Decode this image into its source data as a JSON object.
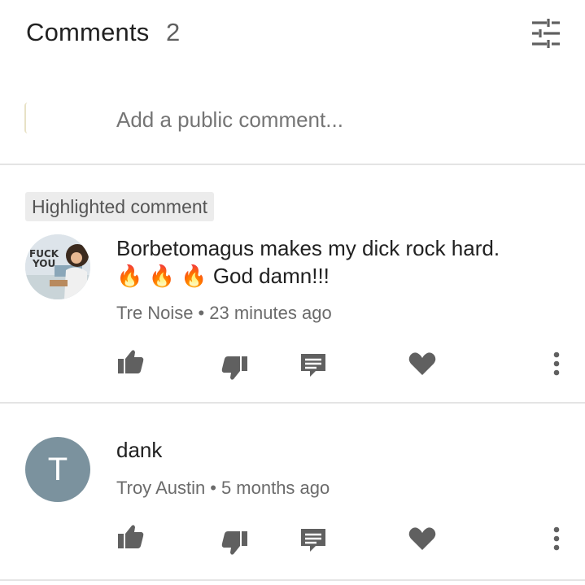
{
  "header": {
    "title": "Comments",
    "count": "2"
  },
  "add_comment": {
    "placeholder": "Add a public comment..."
  },
  "highlighted_label": "Highlighted comment",
  "comments": [
    {
      "avatar_text": "FUCK YOU",
      "line1": "Borbetomagus makes my dick rock hard.",
      "emojis": "🔥 🔥 🔥",
      "line2": "God damn!!!",
      "author": "Tre Noise",
      "separator": "•",
      "time": "23 minutes ago"
    },
    {
      "avatar_letter": "T",
      "text": "dank",
      "author": "Troy Austin",
      "separator": "•",
      "time": "5 months ago"
    }
  ],
  "icons": [
    "sort-icon",
    "thumbs-up-icon",
    "thumbs-down-icon",
    "reply-icon",
    "heart-icon",
    "more-vert-icon"
  ],
  "colors": {
    "icon": "#606060",
    "avatar_t": "#7b929e",
    "divider": "#e4e4e4",
    "badge_bg": "#ececec"
  }
}
